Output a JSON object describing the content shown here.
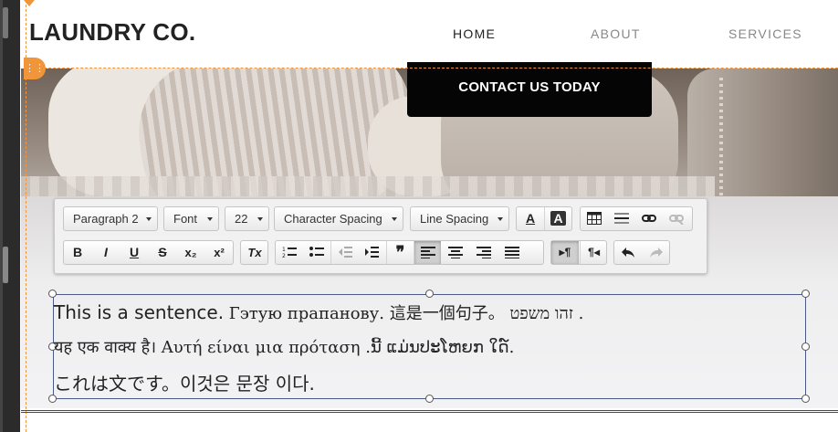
{
  "header": {
    "logo": "LAUNDRY CO.",
    "nav": [
      {
        "label": "HOME"
      },
      {
        "label": "ABOUT"
      },
      {
        "label": "SERVICES"
      }
    ]
  },
  "hero": {
    "contact_label": "CONTACT US TODAY"
  },
  "toolbar": {
    "paragraph": "Paragraph 2",
    "font": "Font",
    "size": "22",
    "char_spacing": "Character Spacing",
    "line_spacing": "Line Spacing",
    "bold": "B",
    "italic": "I",
    "underline": "U",
    "strike": "S",
    "subscript": "x₂",
    "superscript": "x²",
    "clear_format": "Tx",
    "blockquote": "❞",
    "ltr": "▸¶",
    "rtl": "¶◂",
    "text_color": "A",
    "bg_color": "A",
    "icons": [
      "text-color-icon",
      "background-color-icon",
      "table-icon",
      "horizontal-rule-icon",
      "link-icon",
      "unlink-icon",
      "bold-icon",
      "italic-icon",
      "underline-icon",
      "strikethrough-icon",
      "subscript-icon",
      "superscript-icon",
      "clear-formatting-icon",
      "numbered-list-icon",
      "bulleted-list-icon",
      "decrease-indent-icon",
      "increase-indent-icon",
      "blockquote-icon",
      "align-left-icon",
      "align-center-icon",
      "align-right-icon",
      "justify-icon",
      "ltr-icon",
      "rtl-icon",
      "undo-icon",
      "redo-icon"
    ]
  },
  "editor": {
    "line1_bold": "This is a sentence.",
    "line1_rest": " Гэтую прапанову. 這是一個句子。 זהו משפט .",
    "line2": "यह एक वाक्य है। Αυτή είναι μια πρόταση .ນີ້ ແມ່ນປະໂຫຍກ ໃດ໌.",
    "line3": "これは文です。이것은 문장 이다."
  },
  "colors": {
    "accent_orange": "#f0953a",
    "contact_bg": "#050505",
    "selection_border": "#4a5a88"
  }
}
